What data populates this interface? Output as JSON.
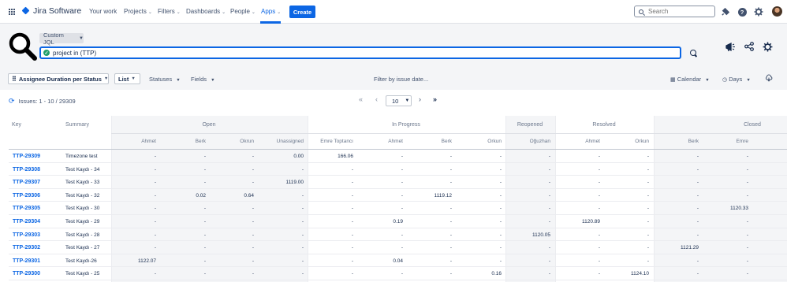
{
  "nav": {
    "product": "Jira Software",
    "items": [
      {
        "label": "Your work",
        "chevron": false
      },
      {
        "label": "Projects",
        "chevron": true
      },
      {
        "label": "Filters",
        "chevron": true
      },
      {
        "label": "Dashboards",
        "chevron": true
      },
      {
        "label": "People",
        "chevron": true
      },
      {
        "label": "Apps",
        "chevron": true
      }
    ],
    "create_label": "Create",
    "search_placeholder": "Search"
  },
  "query": {
    "mode_label": "Custom JQL",
    "jql": "project in (TTP)"
  },
  "toolbar": {
    "report_label": "Assignee Duration per Status",
    "view_label": "List",
    "statuses_label": "Statuses",
    "fields_label": "Fields",
    "filter_date_label": "Filter by issue date...",
    "calendar_label": "Calendar",
    "days_label": "Days"
  },
  "pagination": {
    "summary": "Issues: 1 - 10 / 29309",
    "page_size": "10",
    "first": "«",
    "prev": "‹",
    "next": "›",
    "last": "»"
  },
  "table": {
    "key_header": "Key",
    "summary_header": "Summary",
    "groups": [
      "Open",
      "In Progress",
      "Reopened",
      "Resolved",
      "Closed"
    ],
    "assignee_headers": [
      "Ahmet",
      "Berk",
      "Okrun",
      "Unassigned",
      "Emre Toptancı",
      "Ahmet",
      "Berk",
      "Orkun",
      "Oğuzhan",
      "Ahmet",
      "Orkun",
      "Berk",
      "Emre"
    ],
    "rows": [
      {
        "key": "TTP-29309",
        "summary": "Timezone test",
        "values": [
          "-",
          "-",
          "-",
          "0.00",
          "166.06",
          "-",
          "-",
          "-",
          "-",
          "-",
          "-",
          "-",
          "-"
        ]
      },
      {
        "key": "TTP-29308",
        "summary": "Test Kaydı - 34",
        "values": [
          "-",
          "-",
          "-",
          "-",
          "-",
          "-",
          "-",
          "-",
          "-",
          "-",
          "-",
          "-",
          "-"
        ]
      },
      {
        "key": "TTP-29307",
        "summary": "Test Kaydı - 33",
        "values": [
          "-",
          "-",
          "-",
          "1119.00",
          "-",
          "-",
          "-",
          "-",
          "-",
          "-",
          "-",
          "-",
          "-"
        ]
      },
      {
        "key": "TTP-29306",
        "summary": "Test Kaydı - 32",
        "values": [
          "-",
          "0.02",
          "0.64",
          "-",
          "-",
          "-",
          "1119.12",
          "-",
          "-",
          "-",
          "-",
          "-",
          "-"
        ]
      },
      {
        "key": "TTP-29305",
        "summary": "Test Kaydı - 30",
        "values": [
          "-",
          "-",
          "-",
          "-",
          "-",
          "-",
          "-",
          "-",
          "-",
          "-",
          "-",
          "-",
          "1120.33"
        ]
      },
      {
        "key": "TTP-29304",
        "summary": "Test Kaydı - 29",
        "values": [
          "-",
          "-",
          "-",
          "-",
          "-",
          "0.19",
          "-",
          "-",
          "-",
          "1120.89",
          "-",
          "-",
          "-"
        ]
      },
      {
        "key": "TTP-29303",
        "summary": "Test Kaydı - 28",
        "values": [
          "-",
          "-",
          "-",
          "-",
          "-",
          "-",
          "-",
          "-",
          "1120.05",
          "-",
          "-",
          "-",
          "-"
        ]
      },
      {
        "key": "TTP-29302",
        "summary": "Test Kaydı - 27",
        "values": [
          "-",
          "-",
          "-",
          "-",
          "-",
          "-",
          "-",
          "-",
          "-",
          "-",
          "-",
          "1121.29",
          "-"
        ]
      },
      {
        "key": "TTP-29301",
        "summary": "Test Kaydı-26",
        "values": [
          "1122.07",
          "-",
          "-",
          "-",
          "-",
          "0.04",
          "-",
          "-",
          "-",
          "-",
          "-",
          "-",
          "-"
        ]
      },
      {
        "key": "TTP-29300",
        "summary": "Test Kaydı - 25",
        "values": [
          "-",
          "-",
          "-",
          "-",
          "-",
          "-",
          "-",
          "0.16",
          "-",
          "-",
          "1124.10",
          "-",
          "-"
        ]
      }
    ]
  },
  "colors": {
    "accent": "#0c66e4",
    "success": "#22a06b",
    "header_bg": "#f4f5f7"
  }
}
